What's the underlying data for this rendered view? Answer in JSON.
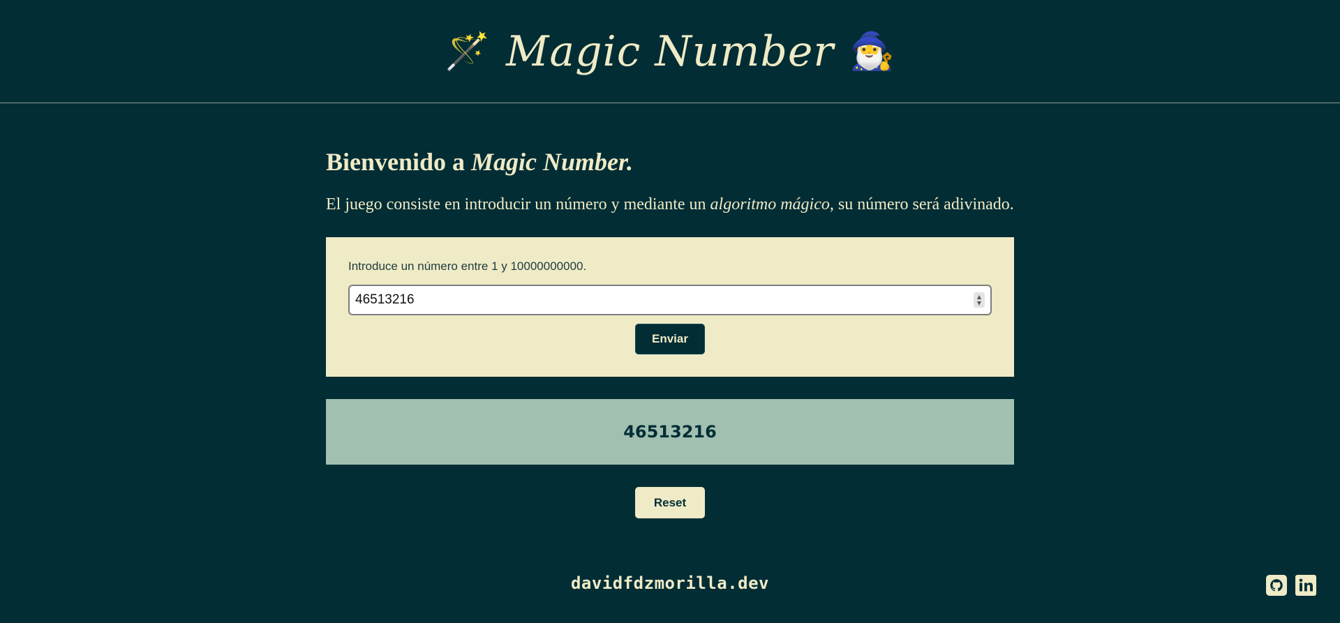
{
  "header": {
    "title": "Magic Number",
    "left_emoji": "🪄",
    "right_emoji": "🧙‍♂️"
  },
  "intro": {
    "welcome_prefix": "Bienvenido a ",
    "welcome_emphasis": "Magic Number.",
    "description_before": "El juego consiste en introducir un número y mediante un ",
    "description_emphasis": "algoritmo mágico",
    "description_after": ", su número será adivinado."
  },
  "form": {
    "label": "Introduce un número entre 1 y 10000000000.",
    "input_value": "46513216",
    "submit_label": "Enviar"
  },
  "result": {
    "value": "46513216"
  },
  "actions": {
    "reset_label": "Reset"
  },
  "footer": {
    "site": "davidfdzmorilla.dev",
    "icons": [
      "github-icon",
      "linkedin-icon"
    ]
  },
  "colors": {
    "background": "#022d35",
    "cream": "#efebc6",
    "result_bg": "#a1c0b0"
  }
}
